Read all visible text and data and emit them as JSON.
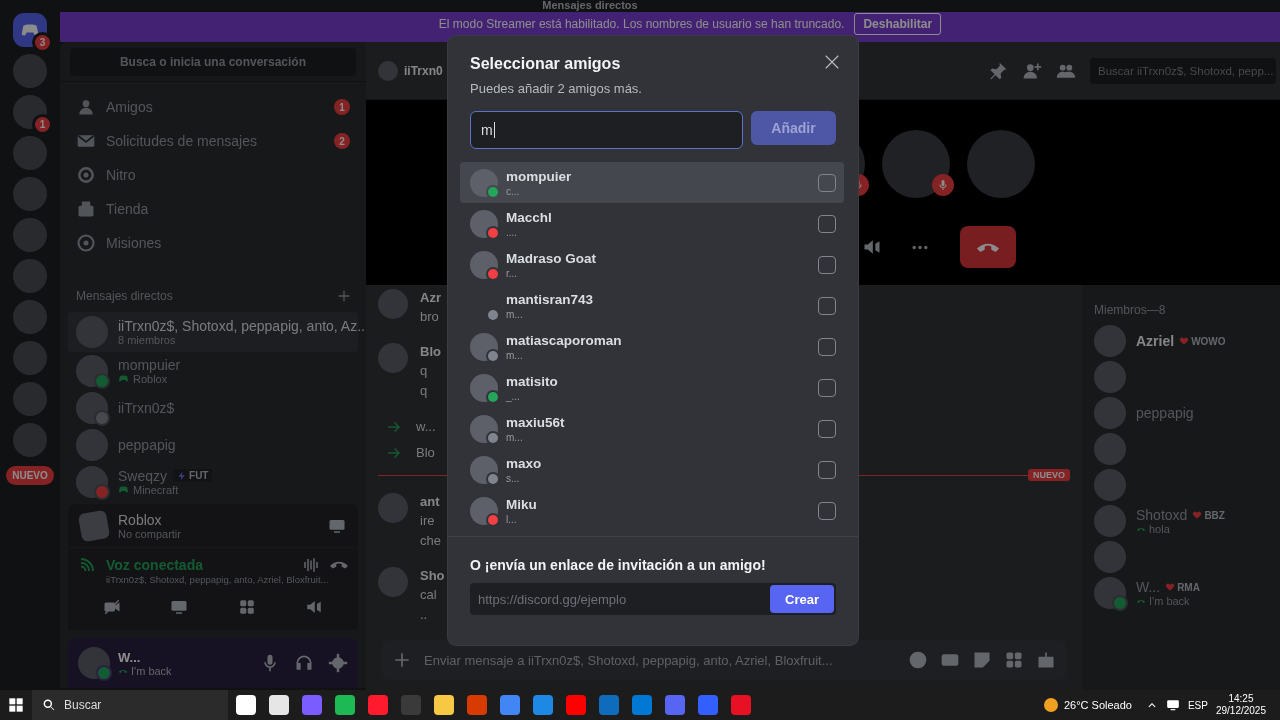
{
  "title_bar": {
    "title": "Mensajes directos"
  },
  "streamer_banner": {
    "message": "El modo Streamer está habilitado. Los nombres de usuario se han truncado.",
    "button": "Deshabilitar"
  },
  "servers": [
    {
      "kind": "home",
      "badge": "3"
    },
    {
      "kind": "server"
    },
    {
      "kind": "server",
      "badge": "1"
    },
    {
      "kind": "server"
    },
    {
      "kind": "server"
    },
    {
      "kind": "server"
    },
    {
      "kind": "server"
    },
    {
      "kind": "server"
    },
    {
      "kind": "server"
    },
    {
      "kind": "server"
    },
    {
      "kind": "server"
    }
  ],
  "servers_new_label": "NUEVO",
  "sidebar": {
    "search": "Busca o inicia una conversación",
    "nav": [
      {
        "label": "Amigos",
        "badge": "1"
      },
      {
        "label": "Solicitudes de mensajes",
        "badge": "2"
      },
      {
        "label": "Nitro"
      },
      {
        "label": "Tienda"
      },
      {
        "label": "Misiones"
      }
    ],
    "dm_header": "Mensajes directos",
    "dms": [
      {
        "kind": "group",
        "name": "iiTrxn0z$, Shotoxd, peppapig, anto, Az...",
        "subtitle": "8 miembros",
        "selected": true
      },
      {
        "kind": "user",
        "name": "mompuier",
        "activity": "Roblox",
        "color": "#135b32",
        "selected": false
      },
      {
        "kind": "user",
        "name": "iiTrxn0z$",
        "color": "#46494e",
        "selected": false
      },
      {
        "kind": "user",
        "name": "peppapig",
        "selected": false
      },
      {
        "kind": "user",
        "name": "Sweqzy",
        "tag": "FUT",
        "activity": "Minecraft",
        "color": "#852325",
        "selected": false
      }
    ]
  },
  "activity_panel": {
    "game": "Roblox",
    "detail": "No compartir"
  },
  "voice_panel": {
    "title": "Voz conectada",
    "channel": "iiTrxn0z$, Shotoxd, peppapig, anto, Azriel, Bloxfruit..."
  },
  "user_panel": {
    "name": "W...",
    "status_text": "I'm back",
    "color": "#135b32"
  },
  "chat": {
    "header_name": "iiTrxn0",
    "search_placeholder": "Buscar iiTrxn0z$, Shotoxd, pepp...",
    "call_participants": [
      {
        "muted": true
      },
      {
        "muted": true
      },
      {
        "muted": false
      }
    ],
    "messages": [
      {
        "kind": "message",
        "author": "Azr",
        "lines": [
          "bro"
        ]
      },
      {
        "kind": "message",
        "author": "Blo",
        "lines": [
          "q",
          "q"
        ]
      },
      {
        "kind": "join",
        "lines": [
          "w..."
        ]
      },
      {
        "kind": "join",
        "lines": [
          "Blo"
        ]
      },
      {
        "kind": "new_divider",
        "label": "NUEVO"
      },
      {
        "kind": "message",
        "author": "ant",
        "lines": [
          "ire",
          "che"
        ]
      },
      {
        "kind": "message",
        "author": "Sho",
        "lines": [
          "cal",
          ".."
        ]
      }
    ],
    "input_placeholder": "Enviar mensaje a iiTrxn0z$, Shotoxd, peppapig, anto, Azriel, Bloxfruit..."
  },
  "members": {
    "header": "Miembros—8",
    "list": [
      {
        "kind": "full",
        "name": "Azriel",
        "tag": "WOWO"
      },
      {
        "kind": "avatar_only"
      },
      {
        "kind": "full",
        "name": "peppapig"
      },
      {
        "kind": "avatar_only"
      },
      {
        "kind": "avatar_only"
      },
      {
        "kind": "full",
        "name": "Shotoxd",
        "tag": "BBZ",
        "status_text": "hola"
      },
      {
        "kind": "avatar_only"
      },
      {
        "kind": "full",
        "name": "W...",
        "tag": "RMA",
        "status_text": "I'm back",
        "color": "#135b32"
      }
    ]
  },
  "modal": {
    "title": "Seleccionar amigos",
    "subtitle": "Puedes añadir 2 amigos más.",
    "search_value": "m",
    "add_button": {
      "label": "Añadir",
      "disabled": true
    },
    "friends": [
      {
        "name": "mompuier",
        "note": "c...",
        "color": "#23a55a",
        "has_avatar": true,
        "checked": false,
        "selected": true
      },
      {
        "name": "Macchl",
        "note": "....",
        "color": "#f23f43",
        "has_avatar": true,
        "checked": false,
        "selected": false
      },
      {
        "name": "Madraso Goat",
        "note": "r...",
        "color": "#f23f43",
        "has_avatar": true,
        "checked": false,
        "selected": false
      },
      {
        "name": "mantisran743",
        "note": "m...",
        "color": "#80848e",
        "has_avatar": false,
        "checked": false,
        "selected": false
      },
      {
        "name": "matiascaporoman",
        "note": "m...",
        "color": "#80848e",
        "has_avatar": true,
        "checked": false,
        "selected": false
      },
      {
        "name": "matisito",
        "note": "_...",
        "color": "#23a55a",
        "has_avatar": true,
        "checked": false,
        "selected": false
      },
      {
        "name": "maxiu56t",
        "note": "m...",
        "color": "#80848e",
        "has_avatar": true,
        "checked": false,
        "selected": false
      },
      {
        "name": "maxo",
        "note": "s...",
        "color": "#80848e",
        "has_avatar": true,
        "checked": false,
        "selected": false
      },
      {
        "name": "Miku",
        "note": "l...",
        "color": "#f23f43",
        "has_avatar": true,
        "checked": false,
        "selected": false
      }
    ],
    "invite_heading": "O ¡envía un enlace de invitación a un amigo!",
    "invite_placeholder": "https://discord.gg/ejemplo",
    "create_button": "Crear"
  },
  "taskbar": {
    "search": "Buscar",
    "apps": [
      {
        "color": "#ffffff"
      },
      {
        "color": "#e6e6e6"
      },
      {
        "color": "#7b5cff"
      },
      {
        "color": "#1db954"
      },
      {
        "color": "#ff1b2d"
      },
      {
        "color": "#3a3a3a"
      },
      {
        "color": "#f7c843"
      },
      {
        "color": "#d83b01"
      },
      {
        "color": "#4285f4"
      },
      {
        "color": "#1e88e5"
      },
      {
        "color": "#ff0000"
      },
      {
        "color": "#0f6cbd"
      },
      {
        "color": "#0078d4"
      },
      {
        "color": "#5865f2"
      },
      {
        "color": "#335fff"
      },
      {
        "color": "#e81123"
      }
    ],
    "weather": "26°C Soleado",
    "language": "ESP",
    "time": "14:25",
    "date": "29/12/2025"
  }
}
